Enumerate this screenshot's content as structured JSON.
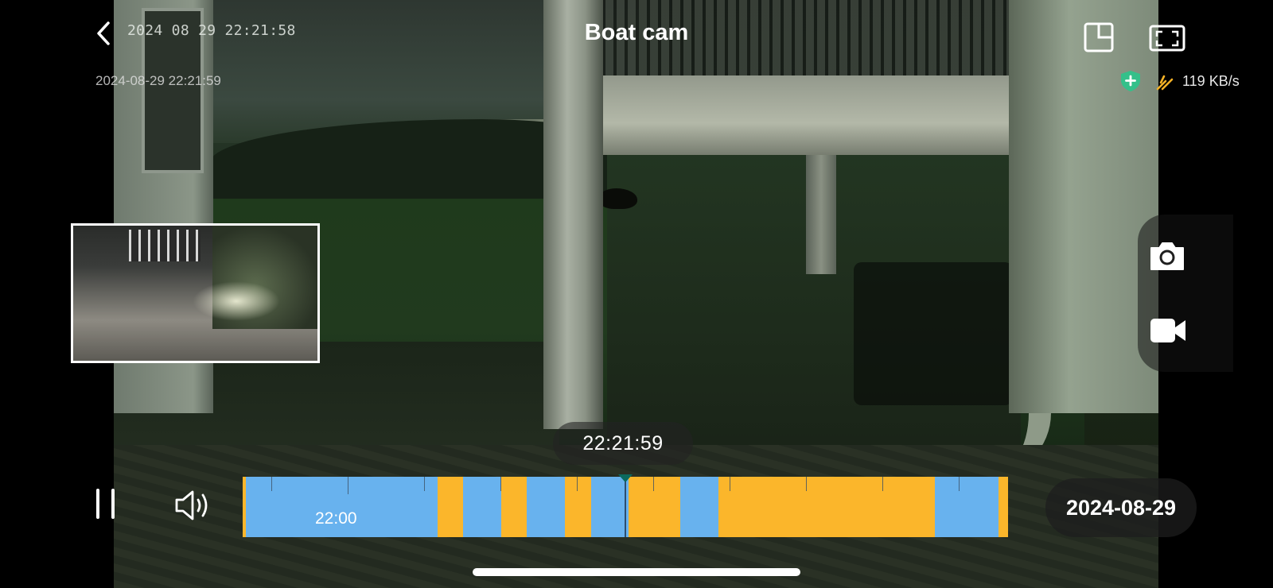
{
  "header": {
    "title": "Boat cam",
    "osd_timestamp": "2024 08 29 22:21:58",
    "recording_datetime": "2024-08-29 22:21:59",
    "bitrate": "119 KB/s"
  },
  "icons": {
    "back": "chevron-left-icon",
    "pip": "picture-in-picture-icon",
    "fullscreen": "fullscreen-icon",
    "security": "shield-plus-icon",
    "bandwidth": "bandwidth-icon",
    "snapshot": "camera-icon",
    "record": "video-camera-icon",
    "pause": "pause-icon",
    "volume": "volume-icon"
  },
  "playback": {
    "current_time": "22:21:59",
    "date": "2024-08-29",
    "timeline_label": "22:00"
  },
  "colors": {
    "timeline_event": "#fbb62b",
    "timeline_continuous": "#68b2ee",
    "shield": "#34c08a",
    "bandwidth_icon": "#f3b126"
  }
}
